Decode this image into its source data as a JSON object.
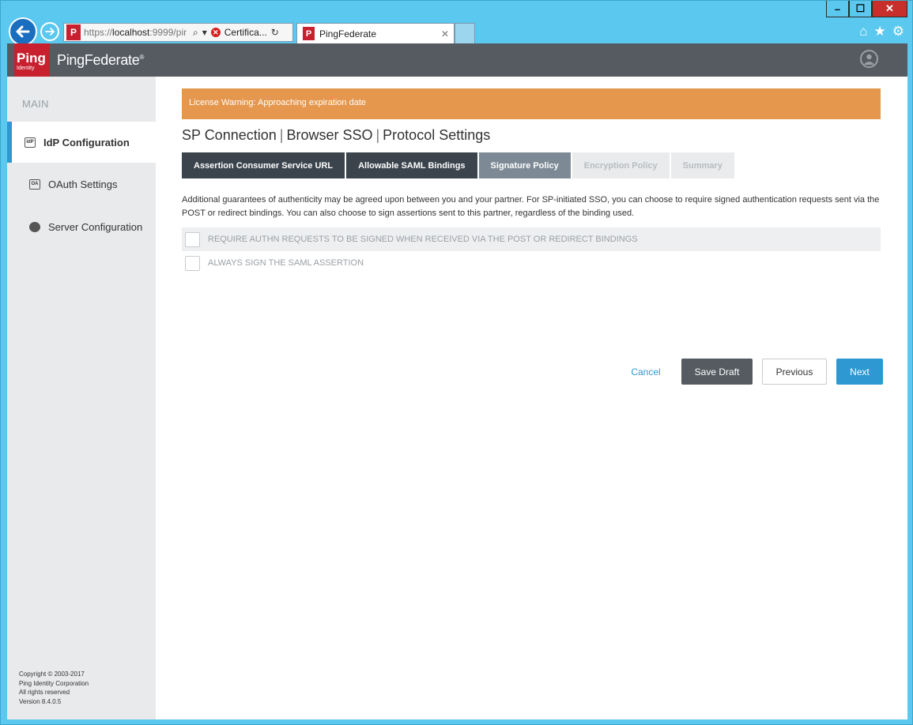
{
  "browser": {
    "url_prefix": "https://",
    "url_host": "localhost",
    "url_rest": ":9999/pir",
    "cert_label": "Certifica...",
    "tab_title": "PingFederate",
    "favicon_letter": "P"
  },
  "header": {
    "logo_text": "Ping",
    "logo_subtext": "Identity",
    "brand": "PingFederate",
    "brand_mark": "®"
  },
  "sidebar": {
    "heading": "MAIN",
    "items": [
      {
        "label": "IdP Configuration",
        "icon": "idp-icon",
        "icon_text": "IdP",
        "active": true
      },
      {
        "label": "OAuth Settings",
        "icon": "oauth-icon",
        "icon_text": "OA",
        "active": false
      },
      {
        "label": "Server Configuration",
        "icon": "server-icon",
        "icon_text": "",
        "active": false
      }
    ],
    "footer": [
      "Copyright © 2003-2017",
      "Ping Identity Corporation",
      "All rights reserved",
      "Version 8.4.0.5"
    ]
  },
  "main": {
    "license_warning": "License Warning: Approaching expiration date",
    "breadcrumb": [
      "SP Connection",
      "Browser SSO",
      "Protocol Settings"
    ],
    "tabs": [
      {
        "label": "Assertion Consumer Service URL",
        "state": "done"
      },
      {
        "label": "Allowable SAML Bindings",
        "state": "done"
      },
      {
        "label": "Signature Policy",
        "state": "current"
      },
      {
        "label": "Encryption Policy",
        "state": "future"
      },
      {
        "label": "Summary",
        "state": "future"
      }
    ],
    "description": "Additional guarantees of authenticity may be agreed upon between you and your partner. For SP-initiated SSO, you can choose to require signed authentication requests sent via the POST or redirect bindings. You can also choose to sign assertions sent to this partner, regardless of the binding used.",
    "options": [
      {
        "label": "REQUIRE AUTHN REQUESTS TO BE SIGNED WHEN RECEIVED VIA THE POST OR REDIRECT BINDINGS",
        "checked": false
      },
      {
        "label": "ALWAYS SIGN THE SAML ASSERTION",
        "checked": false
      }
    ],
    "buttons": {
      "cancel": "Cancel",
      "save_draft": "Save Draft",
      "previous": "Previous",
      "next": "Next"
    }
  },
  "colors": {
    "accent": "#2d98d2",
    "warning": "#e4974d",
    "header": "#555b61",
    "brand_red": "#c8202f"
  }
}
